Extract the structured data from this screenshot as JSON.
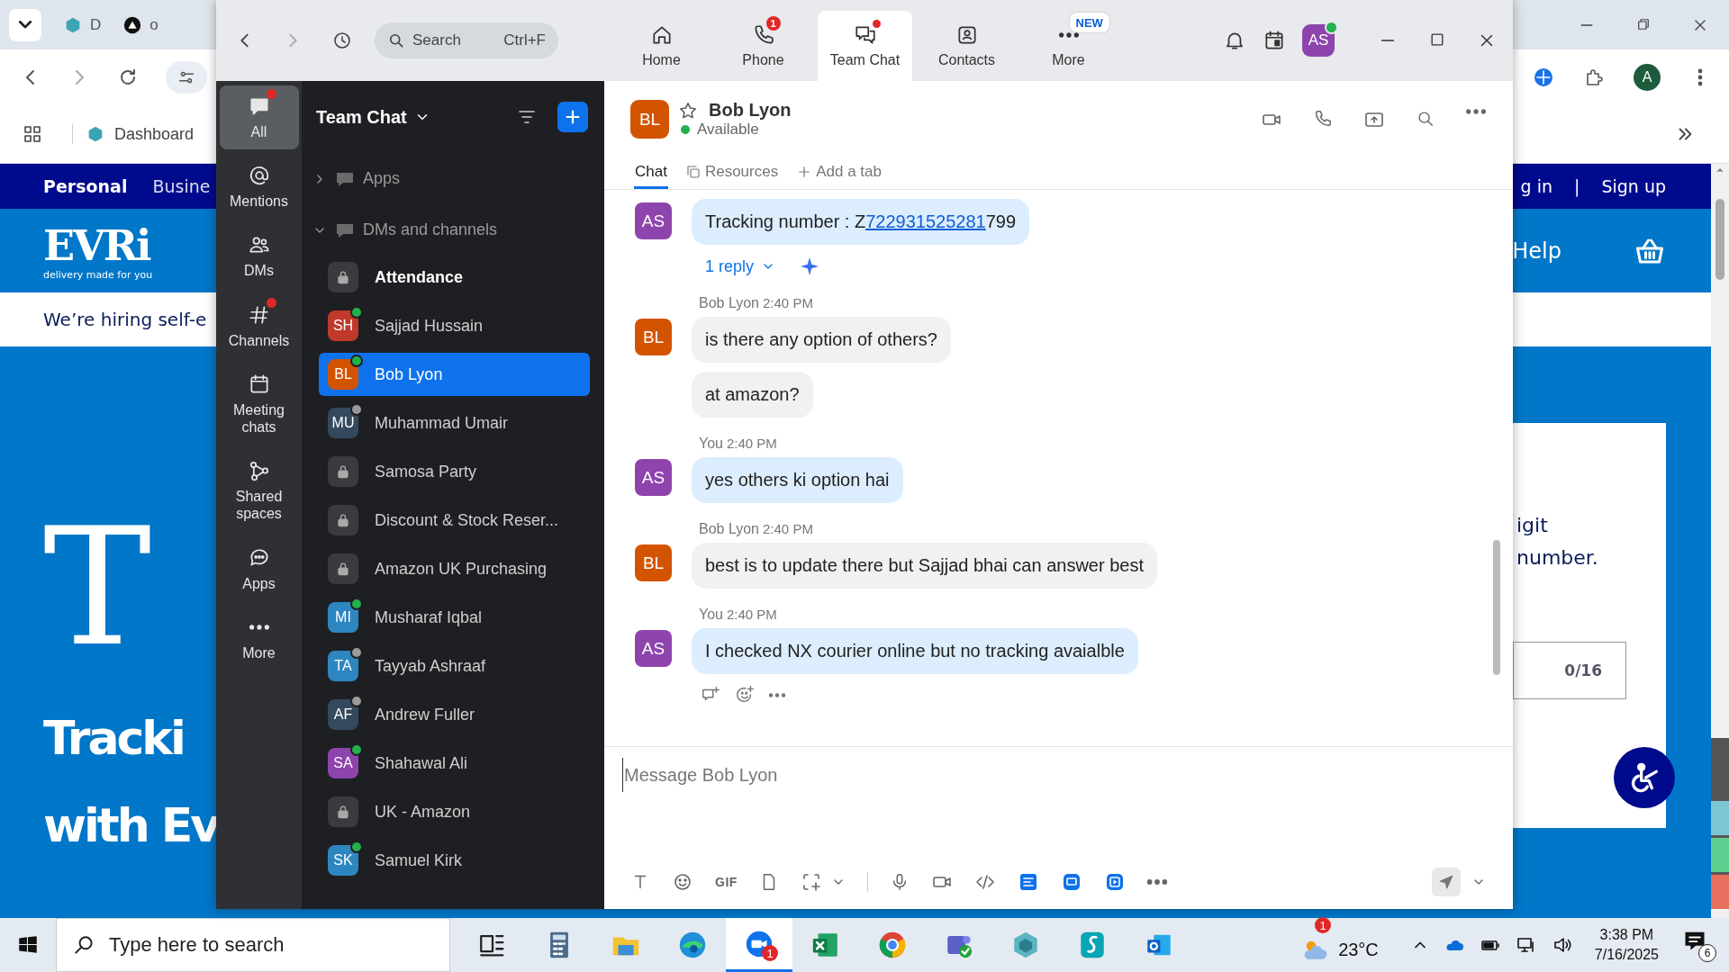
{
  "browser": {
    "tabs": [
      {
        "kind": "hex",
        "label": "D"
      },
      {
        "kind": "disc",
        "label": "o"
      }
    ],
    "bookmarks": [
      {
        "label": "Dashboard"
      }
    ],
    "profile_initial": "A",
    "site": {
      "nav": [
        {
          "label": "Personal",
          "selected": true
        },
        {
          "label": "Busine",
          "selected": false
        }
      ],
      "account_links": [
        "g in",
        "|",
        "Sign up"
      ],
      "logo": {
        "name": "EVRi",
        "tagline": "delivery made for you"
      },
      "help": "Help",
      "banner": "We’re hiring self-e",
      "hero": {
        "glyph": "T",
        "title_lines": [
          "Tracki",
          "with Ev"
        ]
      },
      "card": {
        "lines": [
          "igit",
          "number."
        ],
        "counter": "0/16"
      }
    }
  },
  "app": {
    "search": {
      "placeholder": "Search",
      "shortcut": "Ctrl+F"
    },
    "nav": [
      {
        "kind": "home",
        "label": "Home",
        "selected": false,
        "unread": false
      },
      {
        "kind": "phone",
        "label": "Phone",
        "selected": false,
        "unread": false,
        "badge": "1"
      },
      {
        "kind": "chat",
        "label": "Team Chat",
        "selected": true,
        "unread": true
      },
      {
        "kind": "contacts",
        "label": "Contacts",
        "selected": false,
        "unread": false
      },
      {
        "kind": "more",
        "label": "More",
        "selected": false,
        "unread": false,
        "badge": "NEW"
      }
    ],
    "user": {
      "initials": "AS",
      "online": true
    },
    "rail": [
      {
        "kind": "all",
        "label": "All",
        "selected": true,
        "unread": true
      },
      {
        "kind": "mentions",
        "label": "Mentions",
        "selected": false,
        "unread": false
      },
      {
        "kind": "dms",
        "label": "DMs",
        "selected": false,
        "unread": false
      },
      {
        "kind": "channels",
        "label": "Channels",
        "selected": false,
        "unread": true
      },
      {
        "kind": "meetings",
        "label": "Meeting chats",
        "selected": false,
        "unread": false
      },
      {
        "kind": "spaces",
        "label": "Shared spaces",
        "selected": false,
        "unread": false
      },
      {
        "kind": "apps",
        "label": "Apps",
        "selected": false,
        "unread": false
      },
      {
        "kind": "more",
        "label": "More",
        "selected": false,
        "unread": false
      }
    ],
    "sidebar": {
      "title": "Team Chat",
      "sections": [
        {
          "label": "Apps",
          "expanded": false
        },
        {
          "label": "DMs and channels",
          "expanded": true
        }
      ],
      "items": [
        {
          "kind": "channel",
          "name": "Attendance",
          "unread": true,
          "selected": false
        },
        {
          "kind": "person",
          "initials": "SH",
          "name": "Sajjad Hussain",
          "color": "#c0392b",
          "online": true,
          "unread": false,
          "selected": false
        },
        {
          "kind": "person",
          "initials": "BL",
          "name": "Bob Lyon",
          "color": "#d35400",
          "online": true,
          "unread": false,
          "selected": true
        },
        {
          "kind": "person",
          "initials": "MU",
          "name": "Muhammad Umair",
          "color": "#34495e",
          "online": false,
          "unread": false,
          "selected": false
        },
        {
          "kind": "channel",
          "name": "Samosa Party",
          "unread": false,
          "selected": false
        },
        {
          "kind": "channel",
          "name": "Discount & Stock Reser...",
          "unread": false,
          "selected": false
        },
        {
          "kind": "channel",
          "name": "Amazon UK Purchasing",
          "unread": false,
          "selected": false
        },
        {
          "kind": "person",
          "initials": "MI",
          "name": "Musharaf Iqbal",
          "color": "#2e86c1",
          "online": true,
          "unread": false,
          "selected": false
        },
        {
          "kind": "person",
          "initials": "TA",
          "name": "Tayyab Ashraaf",
          "color": "#2e86c1",
          "online": false,
          "unread": false,
          "selected": false
        },
        {
          "kind": "person",
          "initials": "AF",
          "name": "Andrew Fuller",
          "color": "#34495e",
          "online": false,
          "unread": false,
          "selected": false
        },
        {
          "kind": "person",
          "initials": "SA",
          "name": "Shahawal Ali",
          "color": "#8e44ad",
          "online": true,
          "unread": false,
          "selected": false
        },
        {
          "kind": "channel",
          "name": "UK - Amazon",
          "unread": false,
          "selected": false
        },
        {
          "kind": "person",
          "initials": "SK",
          "name": "Samuel Kirk",
          "color": "#2e86c1",
          "online": true,
          "unread": false,
          "selected": false
        }
      ]
    },
    "chat": {
      "contact": {
        "initials": "BL",
        "color": "#d35400",
        "name": "Bob Lyon",
        "status": "Available",
        "favorite": false
      },
      "tabs": [
        {
          "kind": "chat",
          "label": "Chat",
          "selected": true
        },
        {
          "kind": "resources",
          "label": "Resources",
          "selected": false
        },
        {
          "kind": "add",
          "label": "Add a tab",
          "selected": false
        }
      ],
      "messages": [
        {
          "mine": true,
          "initials": "AS",
          "color": "#8e44ad",
          "show_actions": false,
          "bubbles": [
            {
              "text": "Tracking number : Z",
              "link": "722931525281",
              "after": "799"
            }
          ],
          "replies": "1 reply"
        },
        {
          "mine": false,
          "sender": "Bob Lyon",
          "time": "2:40 PM",
          "initials": "BL",
          "color": "#d35400",
          "show_actions": false,
          "bubbles": [
            {
              "text": "is there any option of others?"
            },
            {
              "text": "at amazon?"
            }
          ]
        },
        {
          "mine": true,
          "sender": "You",
          "time": "2:40 PM",
          "initials": "AS",
          "color": "#8e44ad",
          "show_actions": false,
          "bubbles": [
            {
              "text": "yes others ki option hai"
            }
          ]
        },
        {
          "mine": false,
          "sender": "Bob Lyon",
          "time": "2:40 PM",
          "initials": "BL",
          "color": "#d35400",
          "show_actions": false,
          "bubbles": [
            {
              "text": "best is to update there but Sajjad bhai can answer best"
            }
          ]
        },
        {
          "mine": true,
          "sender": "You",
          "time": "2:40 PM",
          "initials": "AS",
          "color": "#8e44ad",
          "show_actions": true,
          "bubbles": [
            {
              "text": "I checked NX courier online but no tracking avaialble"
            }
          ]
        }
      ],
      "composer": {
        "placeholder": "Message Bob Lyon",
        "gif": "GIF"
      }
    }
  },
  "taskbar": {
    "search_placeholder": "Type here to search",
    "apps": [
      {
        "kind": "taskview",
        "selected": false
      },
      {
        "kind": "calculator",
        "selected": false
      },
      {
        "kind": "folder",
        "selected": false
      },
      {
        "kind": "edge",
        "selected": false
      },
      {
        "kind": "video",
        "selected": true,
        "badge": "1"
      },
      {
        "kind": "sheet",
        "selected": false
      },
      {
        "kind": "chrome",
        "selected": false
      },
      {
        "kind": "teams",
        "selected": false
      },
      {
        "kind": "hex",
        "selected": false
      },
      {
        "kind": "swoosh",
        "selected": false
      },
      {
        "kind": "mail",
        "selected": false
      }
    ],
    "weather": {
      "temp": "23°C",
      "badge": "1"
    },
    "time": "3:38 PM",
    "date": "7/16/2025",
    "notifications": "6"
  }
}
